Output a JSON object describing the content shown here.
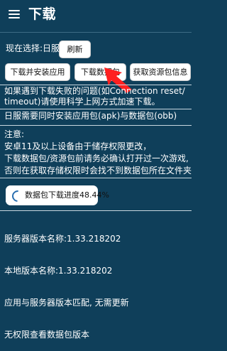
{
  "header": {
    "title": "下载"
  },
  "selection": {
    "current_label": "现在选择:日服",
    "refresh_label": "刷新"
  },
  "actions": {
    "download_install": "下载并安装应用",
    "download_data": "下载数据包",
    "get_resource_info": "获取资源包信息"
  },
  "info": {
    "failure_tip": "如果遇到下载失败的问题(如Connection reset/\ntimeout)请使用科学上网方式加速下载。",
    "install_tip": "日服需要同时安装应用包(apk)与数据包(obb)"
  },
  "notice": {
    "title": "注意:",
    "lines": [
      "安卓11及以上设备由于储存权限更改，",
      "下载数据包/资源包前请务必确认打开过一次游戏,",
      "否则在获取存储权限时会找不到数据包所在文件夹"
    ]
  },
  "progress": {
    "label": "数据包下载进度48.44%",
    "value": 48.44
  },
  "versions": {
    "server": "服务器版本名称:1.33.218202",
    "local": "本地版本名称:1.33.218202",
    "status": "应用与服务器版本匹配, 无需更新",
    "permission": "无权限查看数据包版本"
  },
  "colors": {
    "background": "#0f3f5a",
    "arrow": "#ff2020"
  },
  "icons": {
    "menu": "hamburger-menu-icon",
    "spinner": "loading-spinner-icon",
    "arrow": "red-pointer-arrow-icon"
  }
}
